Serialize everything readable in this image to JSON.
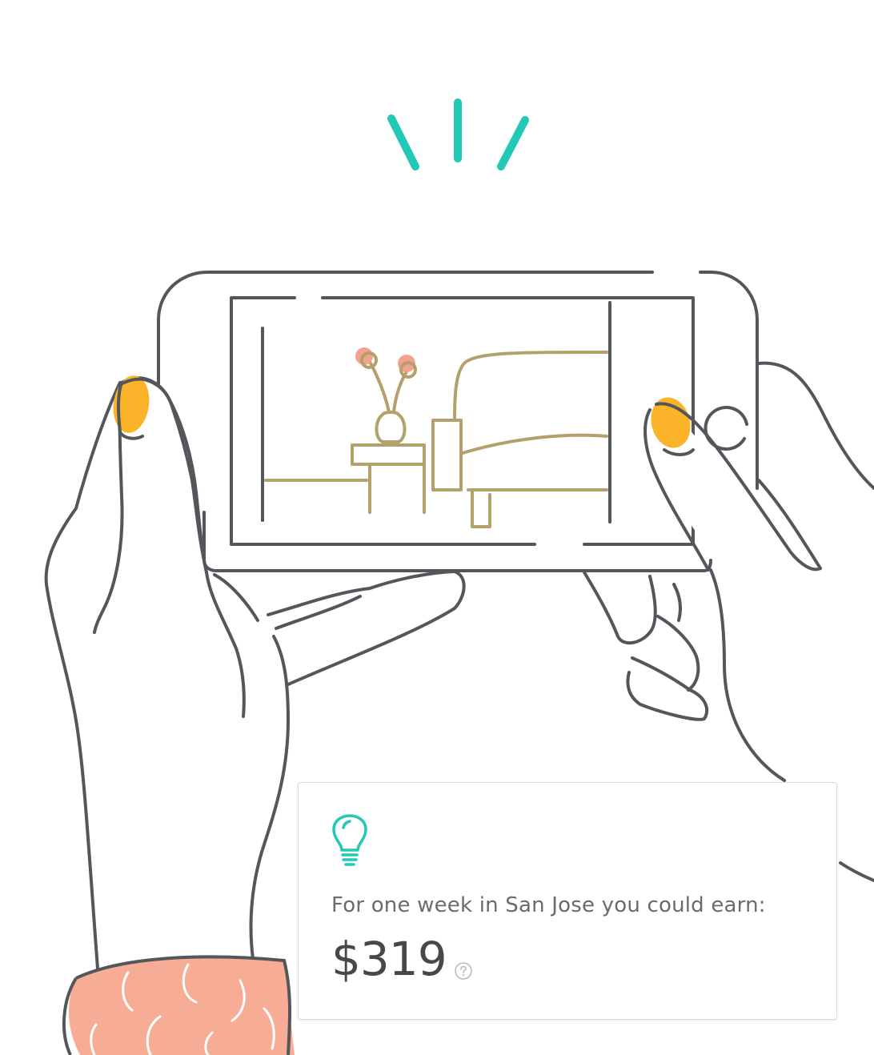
{
  "estimate_card": {
    "label": "For one week in San Jose you could earn:",
    "amount": "$319",
    "icon": "lightbulb-icon",
    "help_icon": "question-mark-icon"
  },
  "colors": {
    "line": "#53575b",
    "accent_teal": "#22c9b6",
    "nail_yellow": "#fbb42a",
    "furniture_gold": "#b3a06a",
    "flower_pink": "#f4a192",
    "sleeve_salmon": "#f7ad95",
    "text_gray": "#6b6b6b",
    "amount_dark": "#484848"
  }
}
